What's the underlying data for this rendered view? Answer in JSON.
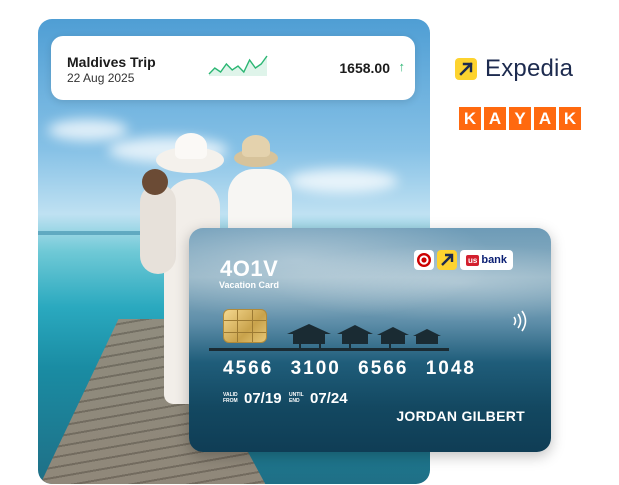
{
  "trip": {
    "title": "Maldives Trip",
    "date": "22 Aug 2025",
    "amount": "1658.00",
    "trend_icon": "arrow-up-icon",
    "trend_color": "#2bb673",
    "sparkline": [
      5,
      8,
      6,
      10,
      7,
      9,
      6,
      12,
      8,
      10,
      14
    ]
  },
  "brands": {
    "expedia": "Expedia",
    "kayak": [
      "K",
      "A",
      "Y",
      "A",
      "K"
    ]
  },
  "card": {
    "issuer": "4O1V",
    "subtitle": "Vacation Card",
    "number_groups": [
      "4566",
      "3100",
      "6566",
      "1048"
    ],
    "valid_from_label": [
      "VALID",
      "FROM"
    ],
    "valid_from": "07/19",
    "until_label": [
      "UNTIL",
      "END"
    ],
    "until": "07/24",
    "holder": "JORDAN GILBERT",
    "partner_usbank": "bank",
    "partner_us": "us"
  },
  "colors": {
    "kayak": "#ff690f",
    "expedia_yellow": "#fdd32f",
    "expedia_text": "#1d2b4f"
  }
}
